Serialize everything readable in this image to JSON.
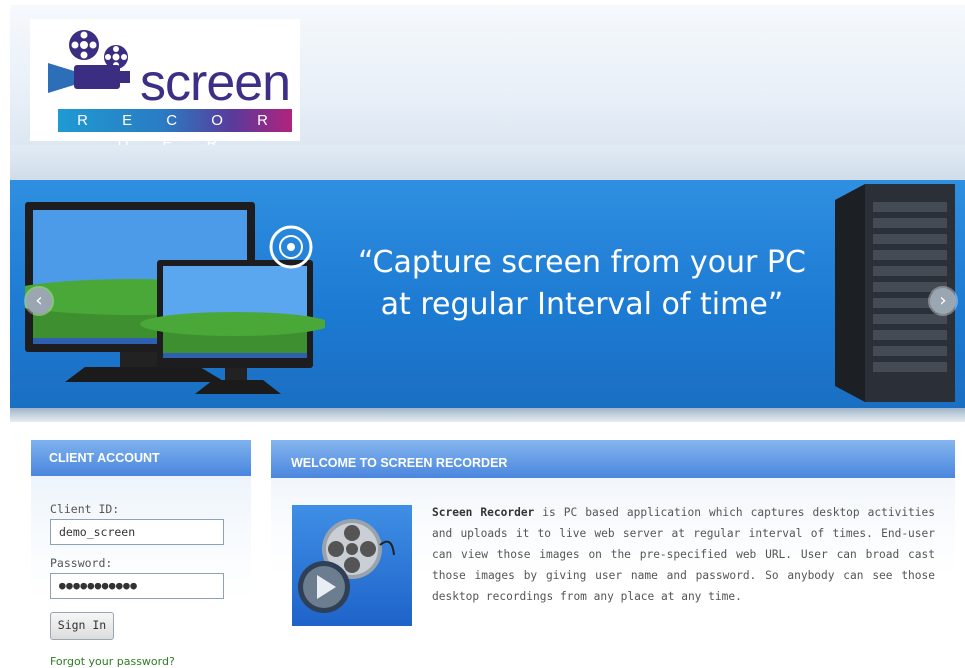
{
  "logo": {
    "word": "screen",
    "subtitle": "R E C O R D E R"
  },
  "banner": {
    "tagline_line1": "“Capture screen from your PC",
    "tagline_line2": "at regular Interval of time”"
  },
  "login": {
    "title": "CLIENT ACCOUNT",
    "client_id_label": "Client ID:",
    "client_id_value": "demo_screen",
    "password_label": "Password:",
    "password_mask": "●●●●●●●●●●●",
    "sign_in": "Sign In",
    "forgot": "Forgot your password?"
  },
  "welcome": {
    "title": "WELCOME TO SCREEN RECORDER",
    "product_name": "Screen Recorder",
    "description": " is PC based application which captures desktop activities and uploads it to live web server at regular interval of times. End-user can view those images on the pre-specified web URL. User can broad cast those images by giving user name and password. So anybody can see those desktop recordings from any place at any time."
  },
  "colors": {
    "accent_blue": "#4a86de",
    "banner_blue": "#1d7bd3",
    "link_green": "#2e7d22"
  },
  "icons": [
    "film-reel-camera-icon",
    "prev-arrow-icon",
    "next-arrow-icon",
    "cd-icon",
    "film-reel-play-icon"
  ]
}
